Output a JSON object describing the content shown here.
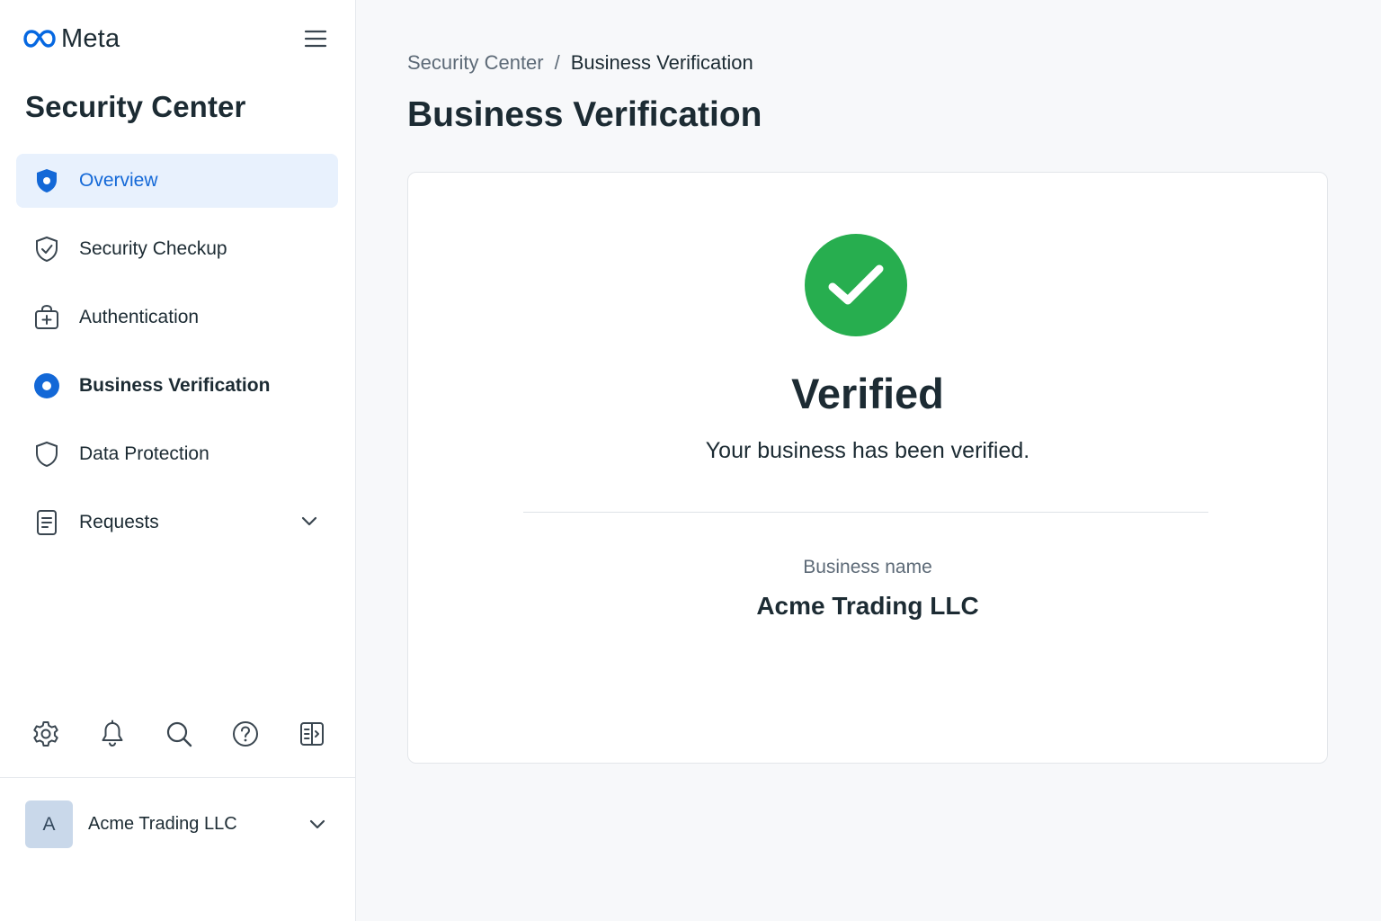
{
  "brand": {
    "name": "Meta",
    "logo_icon": "meta-infinity-logo",
    "brand_color": "#0668e1"
  },
  "sidebar": {
    "title": "Security Center",
    "menu_icon": "hamburger-icon",
    "items": [
      {
        "label": "Overview",
        "icon": "shield-icon",
        "state": "active"
      },
      {
        "label": "Security Checkup",
        "icon": "shield-check-icon"
      },
      {
        "label": "Authentication",
        "icon": "lock-badge-icon"
      },
      {
        "label": "Business Verification",
        "icon": "radio-dot-icon",
        "state": "current"
      },
      {
        "label": "Data Protection",
        "icon": "shield-outline-icon"
      },
      {
        "label": "Requests",
        "icon": "document-icon",
        "expandable": true
      }
    ],
    "tools": [
      "gear-icon",
      "bell-icon",
      "search-icon",
      "help-icon",
      "panel-toggle-icon"
    ],
    "account": {
      "initial": "A",
      "name": "Acme Trading LLC"
    }
  },
  "main": {
    "breadcrumb": {
      "parent": "Security Center",
      "separator": "/",
      "current": "Business Verification"
    },
    "page_title": "Business Verification",
    "card": {
      "status_icon": "check-circle-icon",
      "status_color": "#27ae4f",
      "status_title": "Verified",
      "status_message": "Your business has been verified.",
      "field_label": "Business name",
      "field_value": "Acme Trading LLC"
    }
  },
  "colors": {
    "accent": "#1368d7",
    "active_bg": "#e8f1fd",
    "text": "#1c2b33",
    "muted": "#5d6a77"
  }
}
